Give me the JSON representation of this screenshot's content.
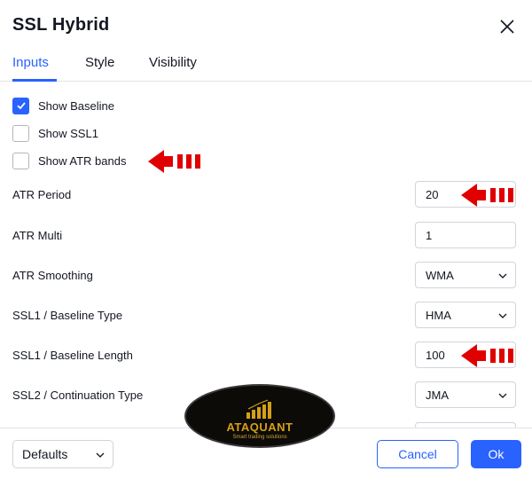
{
  "dialog": {
    "title": "SSL Hybrid",
    "tabs": [
      {
        "label": "Inputs",
        "active": true
      },
      {
        "label": "Style",
        "active": false
      },
      {
        "label": "Visibility",
        "active": false
      }
    ]
  },
  "checkboxes": [
    {
      "label": "Show Baseline",
      "checked": true
    },
    {
      "label": "Show SSL1",
      "checked": false
    },
    {
      "label": "Show ATR bands",
      "checked": false
    }
  ],
  "fields": {
    "atr_period": {
      "label": "ATR Period",
      "value": "20"
    },
    "atr_multi": {
      "label": "ATR Multi",
      "value": "1"
    },
    "atr_smoothing": {
      "label": "ATR Smoothing",
      "value": "WMA"
    },
    "baseline_type": {
      "label": "SSL1 / Baseline Type",
      "value": "HMA"
    },
    "baseline_length": {
      "label": "SSL1 / Baseline Length",
      "value": "100"
    },
    "continuation_type": {
      "label": "SSL2 / Continuation Type",
      "value": "JMA"
    }
  },
  "footer": {
    "defaults_label": "Defaults",
    "cancel_label": "Cancel",
    "ok_label": "Ok"
  },
  "watermark": {
    "name": "ATAQUANT",
    "tagline": "Smart trading solutions"
  },
  "colors": {
    "accent": "#2962ff",
    "arrow": "#e00000",
    "border": "#d1d4dc",
    "logo_gold": "#d4a017"
  },
  "icons": {
    "close": "close-icon",
    "check": "check-icon",
    "chevron": "chevron-down-icon",
    "annotation": "red-arrow-icon"
  }
}
